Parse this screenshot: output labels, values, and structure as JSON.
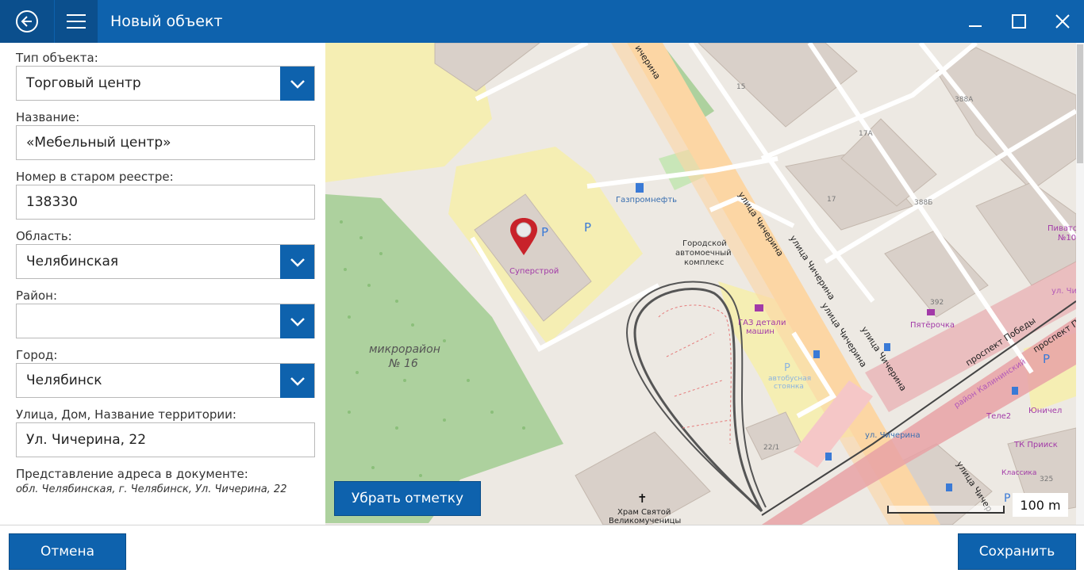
{
  "window": {
    "title": "Новый объект"
  },
  "form": {
    "type": {
      "label": "Тип объекта:",
      "value": "Торговый центр"
    },
    "name": {
      "label": "Название:",
      "value": "«Мебельный центр»"
    },
    "old_registry": {
      "label": "Номер в старом реестре:",
      "value": "138330"
    },
    "region": {
      "label": "Область:",
      "value": "Челябинская"
    },
    "district": {
      "label": "Район:",
      "value": ""
    },
    "city": {
      "label": "Город:",
      "value": "Челябинск"
    },
    "street": {
      "label": "Улица, Дом, Название территории:",
      "value": "Ул. Чичерина, 22"
    },
    "address_doc": {
      "label": "Представление адреса в документе:",
      "value": "обл. Челябинская, г. Челябинск, Ул. Чичерина, 22"
    }
  },
  "map": {
    "remove_mark_label": "Убрать отметку",
    "scale_label": "100 m",
    "labels": {
      "street_a": "ичерина",
      "street_b": "улица Чичерина",
      "street_c": "улица Чичерина",
      "street_d": "улица Чичерина",
      "street_e": "улица Чичерина",
      "street_f": "ул. Чичерина",
      "street_g": "улица Чичер",
      "pobedy_a": "проспект Победы",
      "pobedy_b": "проспект Победы",
      "district_name": "район Калининский",
      "ul_chi": "ул. Чи",
      "microdistrict_1": "микрорайон",
      "microdistrict_2": "№ 16",
      "superstroy": "Суперстрой",
      "gazprom": "Газпромнефть",
      "carwash_1": "Городской",
      "carwash_2": "автомоечный",
      "carwash_3": "комплекс",
      "gaz_1": "ГАЗ детали",
      "gaz_2": "машин",
      "parking_1": "автобусная",
      "parking_2": "стоянка",
      "pyaterochka": "Пятёрочка",
      "tele2": "Теле2",
      "yunichel": "Юничел",
      "tk_prisk": "ТК Прииск",
      "klassika": "Классика",
      "pivato_1": "Пивато",
      "pivato_2": "№10",
      "church_1": "Храм Святой",
      "church_2": "Великомученицы",
      "h15": "15",
      "h388a": "388А",
      "h17a": "17А",
      "h17": "17",
      "h388b": "388Б",
      "h392": "392",
      "h22_1": "22/1",
      "h325": "325",
      "park_p": "P"
    }
  },
  "footer": {
    "cancel_label": "Отмена",
    "save_label": "Сохранить"
  },
  "colors": {
    "accent": "#0e62ad",
    "accent_dark": "#0b4f8d",
    "marker": "#c8222a"
  }
}
